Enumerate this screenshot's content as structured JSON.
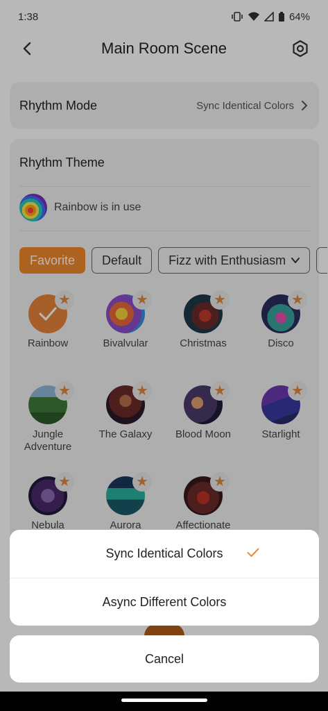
{
  "status_bar": {
    "time": "1:38",
    "battery": "64%"
  },
  "header": {
    "title": "Main Room Scene"
  },
  "rhythm_mode": {
    "label": "Rhythm Mode",
    "value": "Sync Identical Colors"
  },
  "rhythm_theme": {
    "title": "Rhythm Theme",
    "in_use": "Rainbow is in use",
    "tabs": [
      "Favorite",
      "Default",
      "Fizz with Enthusiasm"
    ],
    "active_tab": "Favorite",
    "items": [
      {
        "name": "Rainbow",
        "selected": true
      },
      {
        "name": "Bivalvular"
      },
      {
        "name": "Christmas"
      },
      {
        "name": "Disco"
      },
      {
        "name": "Jungle Adventure"
      },
      {
        "name": "The Galaxy"
      },
      {
        "name": "Blood Moon"
      },
      {
        "name": "Starlight"
      },
      {
        "name": "Nebula"
      },
      {
        "name": "Aurora"
      },
      {
        "name": "Affectionate"
      }
    ]
  },
  "action_sheet": {
    "options": [
      "Sync Identical Colors",
      "Async Different Colors"
    ],
    "selected": "Sync Identical Colors",
    "cancel": "Cancel"
  },
  "colors": {
    "accent": "#f08a2c",
    "star": "#e0893a"
  }
}
